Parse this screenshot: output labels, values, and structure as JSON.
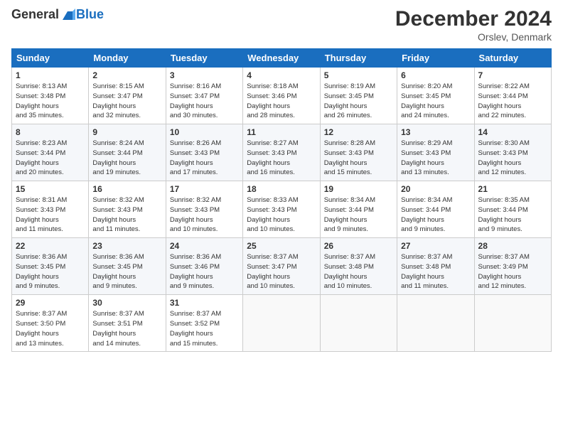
{
  "header": {
    "logo_general": "General",
    "logo_blue": "Blue",
    "title": "December 2024",
    "location": "Orslev, Denmark"
  },
  "days_of_week": [
    "Sunday",
    "Monday",
    "Tuesday",
    "Wednesday",
    "Thursday",
    "Friday",
    "Saturday"
  ],
  "weeks": [
    [
      {
        "day": 1,
        "sunrise": "8:13 AM",
        "sunset": "3:48 PM",
        "daylight": "7 hours and 35 minutes."
      },
      {
        "day": 2,
        "sunrise": "8:15 AM",
        "sunset": "3:47 PM",
        "daylight": "7 hours and 32 minutes."
      },
      {
        "day": 3,
        "sunrise": "8:16 AM",
        "sunset": "3:47 PM",
        "daylight": "7 hours and 30 minutes."
      },
      {
        "day": 4,
        "sunrise": "8:18 AM",
        "sunset": "3:46 PM",
        "daylight": "7 hours and 28 minutes."
      },
      {
        "day": 5,
        "sunrise": "8:19 AM",
        "sunset": "3:45 PM",
        "daylight": "7 hours and 26 minutes."
      },
      {
        "day": 6,
        "sunrise": "8:20 AM",
        "sunset": "3:45 PM",
        "daylight": "7 hours and 24 minutes."
      },
      {
        "day": 7,
        "sunrise": "8:22 AM",
        "sunset": "3:44 PM",
        "daylight": "7 hours and 22 minutes."
      }
    ],
    [
      {
        "day": 8,
        "sunrise": "8:23 AM",
        "sunset": "3:44 PM",
        "daylight": "7 hours and 20 minutes."
      },
      {
        "day": 9,
        "sunrise": "8:24 AM",
        "sunset": "3:44 PM",
        "daylight": "7 hours and 19 minutes."
      },
      {
        "day": 10,
        "sunrise": "8:26 AM",
        "sunset": "3:43 PM",
        "daylight": "7 hours and 17 minutes."
      },
      {
        "day": 11,
        "sunrise": "8:27 AM",
        "sunset": "3:43 PM",
        "daylight": "7 hours and 16 minutes."
      },
      {
        "day": 12,
        "sunrise": "8:28 AM",
        "sunset": "3:43 PM",
        "daylight": "7 hours and 15 minutes."
      },
      {
        "day": 13,
        "sunrise": "8:29 AM",
        "sunset": "3:43 PM",
        "daylight": "7 hours and 13 minutes."
      },
      {
        "day": 14,
        "sunrise": "8:30 AM",
        "sunset": "3:43 PM",
        "daylight": "7 hours and 12 minutes."
      }
    ],
    [
      {
        "day": 15,
        "sunrise": "8:31 AM",
        "sunset": "3:43 PM",
        "daylight": "7 hours and 11 minutes."
      },
      {
        "day": 16,
        "sunrise": "8:32 AM",
        "sunset": "3:43 PM",
        "daylight": "7 hours and 11 minutes."
      },
      {
        "day": 17,
        "sunrise": "8:32 AM",
        "sunset": "3:43 PM",
        "daylight": "7 hours and 10 minutes."
      },
      {
        "day": 18,
        "sunrise": "8:33 AM",
        "sunset": "3:43 PM",
        "daylight": "7 hours and 10 minutes."
      },
      {
        "day": 19,
        "sunrise": "8:34 AM",
        "sunset": "3:44 PM",
        "daylight": "7 hours and 9 minutes."
      },
      {
        "day": 20,
        "sunrise": "8:34 AM",
        "sunset": "3:44 PM",
        "daylight": "7 hours and 9 minutes."
      },
      {
        "day": 21,
        "sunrise": "8:35 AM",
        "sunset": "3:44 PM",
        "daylight": "7 hours and 9 minutes."
      }
    ],
    [
      {
        "day": 22,
        "sunrise": "8:36 AM",
        "sunset": "3:45 PM",
        "daylight": "7 hours and 9 minutes."
      },
      {
        "day": 23,
        "sunrise": "8:36 AM",
        "sunset": "3:45 PM",
        "daylight": "7 hours and 9 minutes."
      },
      {
        "day": 24,
        "sunrise": "8:36 AM",
        "sunset": "3:46 PM",
        "daylight": "7 hours and 9 minutes."
      },
      {
        "day": 25,
        "sunrise": "8:37 AM",
        "sunset": "3:47 PM",
        "daylight": "7 hours and 10 minutes."
      },
      {
        "day": 26,
        "sunrise": "8:37 AM",
        "sunset": "3:48 PM",
        "daylight": "7 hours and 10 minutes."
      },
      {
        "day": 27,
        "sunrise": "8:37 AM",
        "sunset": "3:48 PM",
        "daylight": "7 hours and 11 minutes."
      },
      {
        "day": 28,
        "sunrise": "8:37 AM",
        "sunset": "3:49 PM",
        "daylight": "7 hours and 12 minutes."
      }
    ],
    [
      {
        "day": 29,
        "sunrise": "8:37 AM",
        "sunset": "3:50 PM",
        "daylight": "7 hours and 13 minutes."
      },
      {
        "day": 30,
        "sunrise": "8:37 AM",
        "sunset": "3:51 PM",
        "daylight": "7 hours and 14 minutes."
      },
      {
        "day": 31,
        "sunrise": "8:37 AM",
        "sunset": "3:52 PM",
        "daylight": "7 hours and 15 minutes."
      },
      null,
      null,
      null,
      null
    ]
  ]
}
